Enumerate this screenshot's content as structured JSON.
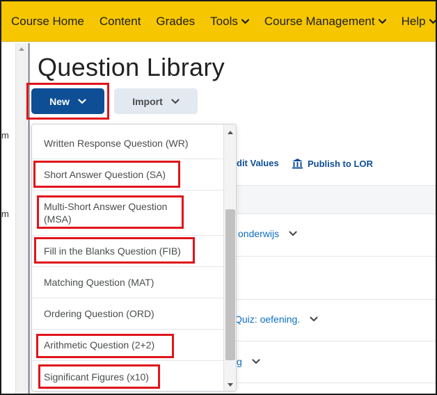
{
  "nav": {
    "items": [
      {
        "label": "Course Home",
        "has_menu": false
      },
      {
        "label": "Content",
        "has_menu": false
      },
      {
        "label": "Grades",
        "has_menu": false
      },
      {
        "label": "Tools",
        "has_menu": true
      },
      {
        "label": "Course Management",
        "has_menu": true
      },
      {
        "label": "Help",
        "has_menu": true
      }
    ]
  },
  "gutter": {
    "letters": [
      "m",
      "m"
    ]
  },
  "page": {
    "title": "Question Library"
  },
  "toolbar": {
    "new_label": "New",
    "import_label": "Import"
  },
  "actions": {
    "edit_values": "dit Values",
    "publish_lor": "Publish to LOR"
  },
  "rows": [
    {
      "text": "onderwijs"
    },
    {
      "text": "Quiz: oefening."
    },
    {
      "text": "g"
    }
  ],
  "dropdown": {
    "items": [
      {
        "label": "Written Response Question (WR)",
        "highlighted": false
      },
      {
        "label": "Short Answer Question (SA)",
        "highlighted": true
      },
      {
        "label": "Multi-Short Answer Question (MSA)",
        "highlighted": true
      },
      {
        "label": "Fill in the Blanks Question (FIB)",
        "highlighted": true
      },
      {
        "label": "Matching Question (MAT)",
        "highlighted": false
      },
      {
        "label": "Ordering Question (ORD)",
        "highlighted": false
      },
      {
        "label": "Arithmetic Question (2+2)",
        "highlighted": true
      },
      {
        "label": "Significant Figures (x10)",
        "highlighted": true
      }
    ]
  },
  "colors": {
    "nav_bg": "#f6c600",
    "primary": "#0e4e94",
    "highlight": "#e0141b",
    "link": "#0e6ec0"
  }
}
